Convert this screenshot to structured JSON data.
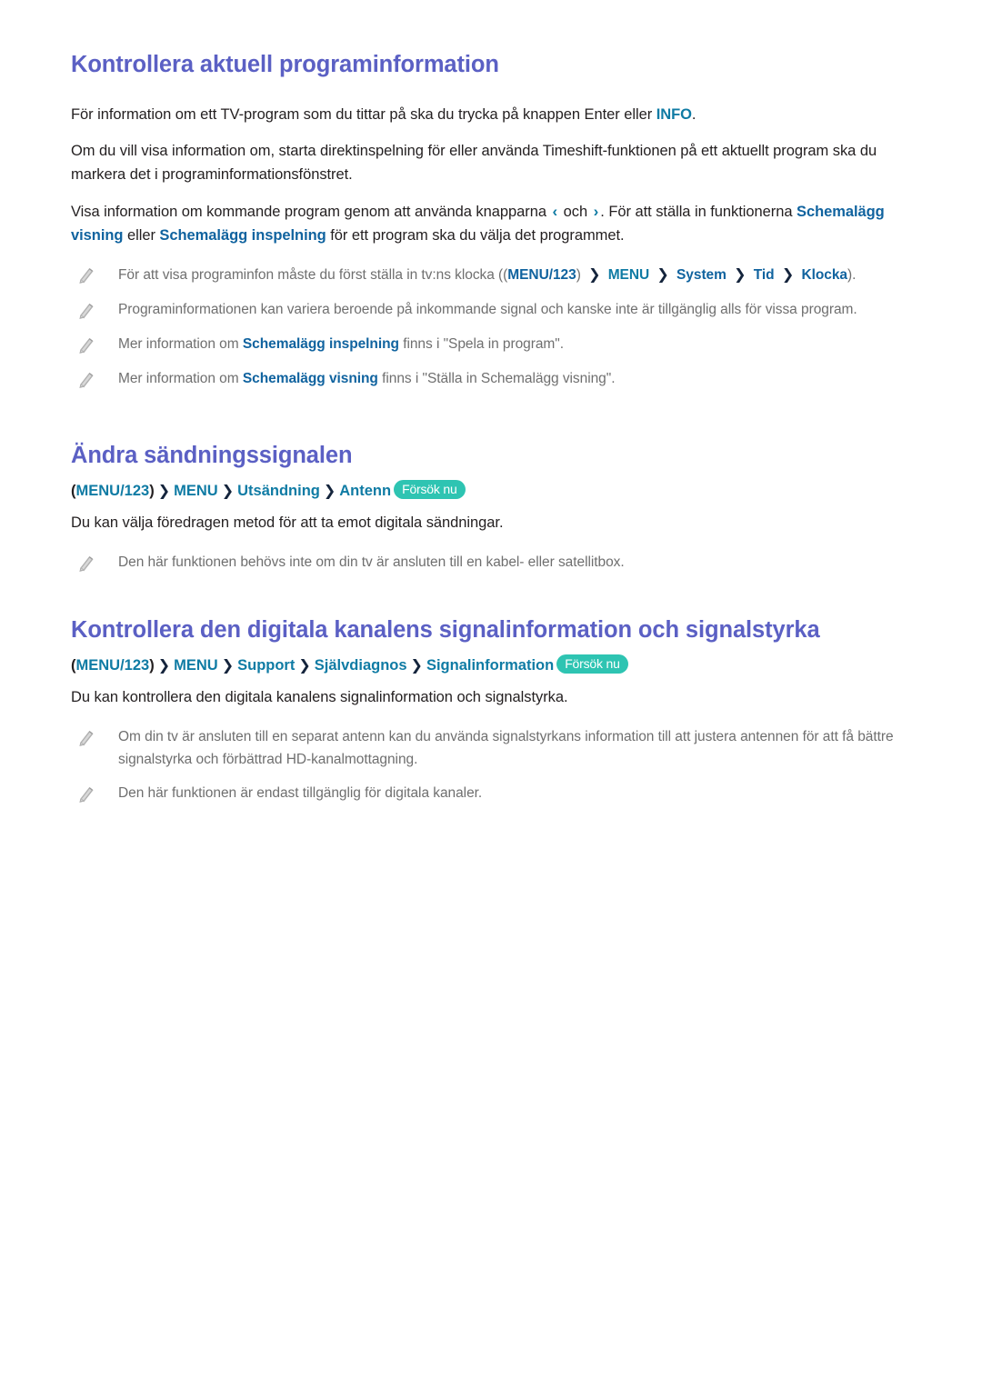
{
  "document": {
    "language": "sv",
    "background_color": "#ffffff"
  },
  "colors": {
    "heading_purple": "#5b60c4",
    "keyword_teal": "#0f7ba4",
    "keyword_blue": "#10639f",
    "body_text": "#231f20",
    "note_text": "#6f6f6f",
    "badge_teal": "#2ec4b2",
    "chevron_dark": "#14243c"
  },
  "icons": {
    "note_bullet": "pencil-icon",
    "chevron_left": "‹",
    "chevron_right": "›",
    "path_separator": "❯"
  },
  "badge": {
    "try_now_label": "Försök nu"
  },
  "sections": [
    {
      "id": "current-program-info",
      "heading": "Kontrollera aktuell programinformation",
      "paragraphs": [
        {
          "id": "para-info-button",
          "parts": [
            {
              "type": "text",
              "value": "För information om ett TV-program som du tittar på ska du trycka på knappen Enter eller "
            },
            {
              "type": "keyword-teal",
              "value": "INFO"
            },
            {
              "type": "text",
              "value": "."
            }
          ]
        },
        {
          "id": "para-timeshift",
          "parts": [
            {
              "type": "text",
              "value": "Om du vill visa information om, starta direktinspelning för eller använda Timeshift-funktionen på ett aktuellt program ska du markera det i programinformationsfönstret."
            }
          ]
        },
        {
          "id": "para-upcoming",
          "parts": [
            {
              "type": "text",
              "value": "Visa information om kommande program genom att använda knapparna "
            },
            {
              "type": "chevron-left",
              "value": "‹"
            },
            {
              "type": "text",
              "value": " och "
            },
            {
              "type": "chevron-right",
              "value": "›"
            },
            {
              "type": "text",
              "value": ". För att ställa in funktionerna "
            },
            {
              "type": "keyword-blue",
              "value": "Schemalägg visning"
            },
            {
              "type": "text",
              "value": " eller "
            },
            {
              "type": "keyword-blue",
              "value": "Schemalägg inspelning"
            },
            {
              "type": "text",
              "value": " för ett program ska du välja det programmet."
            }
          ]
        }
      ],
      "notes": [
        {
          "id": "note-clock",
          "parts": [
            {
              "type": "text",
              "value": "För att visa programinfon måste du först ställa in tv:ns klocka (("
            },
            {
              "type": "keyword-blue",
              "value": "MENU/123"
            },
            {
              "type": "text",
              "value": ") "
            },
            {
              "type": "separator",
              "value": "❯"
            },
            {
              "type": "text",
              "value": " "
            },
            {
              "type": "keyword-teal",
              "value": "MENU"
            },
            {
              "type": "text",
              "value": " "
            },
            {
              "type": "separator",
              "value": "❯"
            },
            {
              "type": "text",
              "value": " "
            },
            {
              "type": "keyword-blue",
              "value": "System"
            },
            {
              "type": "text",
              "value": " "
            },
            {
              "type": "separator",
              "value": "❯"
            },
            {
              "type": "text",
              "value": " "
            },
            {
              "type": "keyword-blue",
              "value": "Tid"
            },
            {
              "type": "text",
              "value": " "
            },
            {
              "type": "separator",
              "value": "❯"
            },
            {
              "type": "text",
              "value": " "
            },
            {
              "type": "keyword-blue",
              "value": "Klocka"
            },
            {
              "type": "text",
              "value": ")."
            }
          ]
        },
        {
          "id": "note-signal-variation",
          "parts": [
            {
              "type": "text",
              "value": "Programinformationen kan variera beroende på inkommande signal och kanske inte är tillgänglig alls för vissa program."
            }
          ]
        },
        {
          "id": "note-more-recording",
          "parts": [
            {
              "type": "text",
              "value": "Mer information om "
            },
            {
              "type": "keyword-blue",
              "value": "Schemalägg inspelning"
            },
            {
              "type": "text",
              "value": " finns i \"Spela in program\"."
            }
          ]
        },
        {
          "id": "note-more-viewing",
          "parts": [
            {
              "type": "text",
              "value": "Mer information om "
            },
            {
              "type": "keyword-blue",
              "value": "Schemalägg visning"
            },
            {
              "type": "text",
              "value": " finns i \"Ställa in Schemalägg visning\"."
            }
          ]
        }
      ]
    },
    {
      "id": "change-broadcast-signal",
      "heading": "Ändra sändningssignalen",
      "menu_path": {
        "open_paren": "(",
        "items": [
          {
            "label": "MENU/123",
            "style": "teal",
            "trailing_paren": ")"
          },
          {
            "label": "MENU",
            "style": "teal"
          },
          {
            "label": "Utsändning",
            "style": "teal"
          },
          {
            "label": "Antenn",
            "style": "teal"
          }
        ],
        "separator": "❯",
        "badge": "Försök nu"
      },
      "paragraphs": [
        {
          "id": "para-preferred-method",
          "parts": [
            {
              "type": "text",
              "value": "Du kan välja föredragen metod för att ta emot digitala sändningar."
            }
          ]
        }
      ],
      "notes": [
        {
          "id": "note-cable-satellite",
          "parts": [
            {
              "type": "text",
              "value": "Den här funktionen behövs inte om din tv är ansluten till en kabel- eller satellitbox."
            }
          ]
        }
      ]
    },
    {
      "id": "digital-channel-signal-info",
      "heading": "Kontrollera den digitala kanalens signalinformation och signalstyrka",
      "menu_path": {
        "open_paren": "(",
        "items": [
          {
            "label": "MENU/123",
            "style": "teal",
            "trailing_paren": ")"
          },
          {
            "label": "MENU",
            "style": "teal"
          },
          {
            "label": "Support",
            "style": "teal"
          },
          {
            "label": "Självdiagnos",
            "style": "teal"
          },
          {
            "label": "Signalinformation",
            "style": "teal"
          }
        ],
        "separator": "❯",
        "badge": "Försök nu"
      },
      "paragraphs": [
        {
          "id": "para-check-signal",
          "parts": [
            {
              "type": "text",
              "value": "Du kan kontrollera den digitala kanalens signalinformation och signalstyrka."
            }
          ]
        }
      ],
      "notes": [
        {
          "id": "note-antenna-adjust",
          "parts": [
            {
              "type": "text",
              "value": "Om din tv är ansluten till en separat antenn kan du använda signalstyrkans information till att justera antennen för att få bättre signalstyrka och förbättrad HD-kanalmottagning."
            }
          ]
        },
        {
          "id": "note-digital-only",
          "parts": [
            {
              "type": "text",
              "value": "Den här funktionen är endast tillgänglig för digitala kanaler."
            }
          ]
        }
      ]
    }
  ]
}
